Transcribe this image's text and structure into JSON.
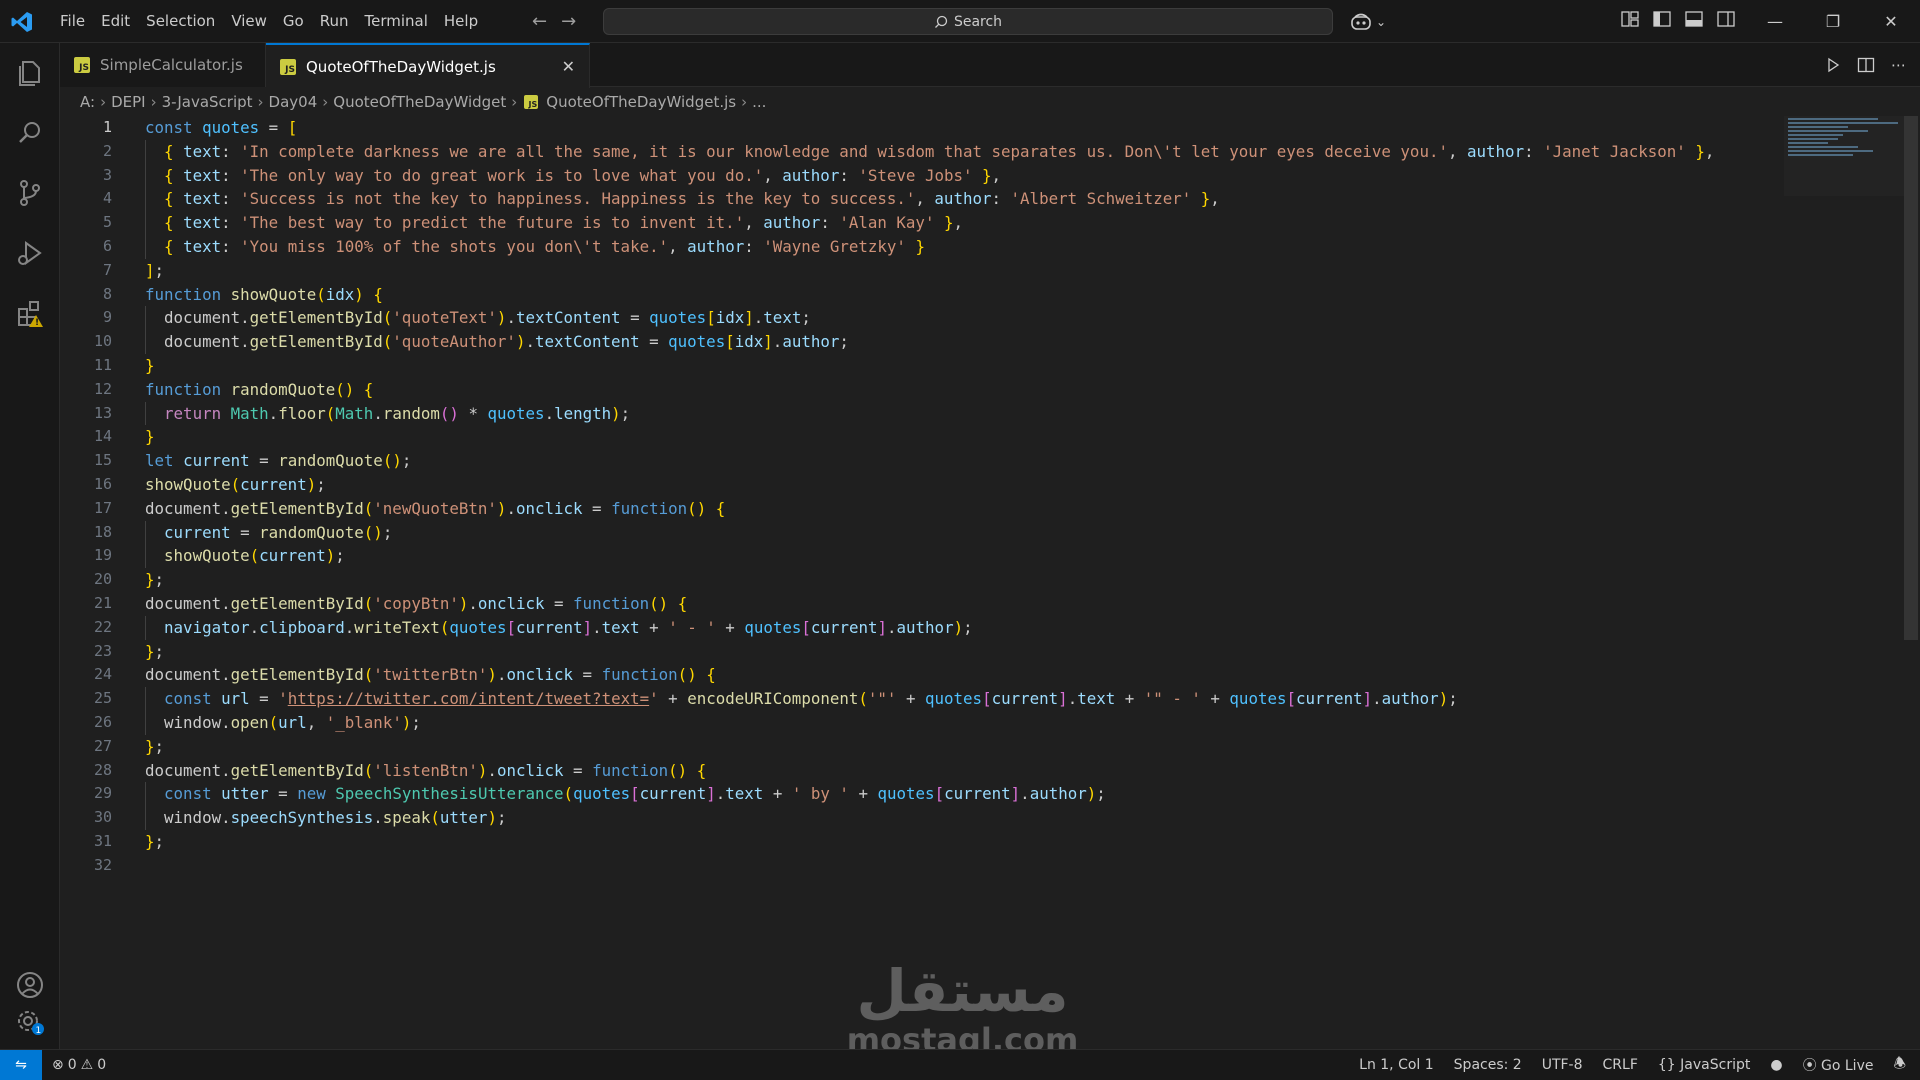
{
  "menu": [
    "File",
    "Edit",
    "Selection",
    "View",
    "Go",
    "Run",
    "Terminal",
    "Help"
  ],
  "search": {
    "label": "Search"
  },
  "tabs": [
    {
      "label": "SimpleCalculator.js",
      "badge": "JS"
    },
    {
      "label": "QuoteOfTheDayWidget.js",
      "badge": "JS"
    }
  ],
  "breadcrumb": [
    "A:",
    "DEPI",
    "3-JavaScript",
    "Day04",
    "QuoteOfTheDayWidget",
    "QuoteOfTheDayWidget.js",
    "..."
  ],
  "line_numbers": [
    "1",
    "2",
    "3",
    "4",
    "5",
    "6",
    "7",
    "8",
    "9",
    "10",
    "11",
    "12",
    "13",
    "14",
    "15",
    "16",
    "17",
    "18",
    "19",
    "20",
    "21",
    "22",
    "23",
    "24",
    "25",
    "26",
    "27",
    "28",
    "29",
    "30",
    "31",
    "32"
  ],
  "code_lines": [
    "const quotes = [",
    "  { text: 'In complete darkness we are all the same, it is our knowledge and wisdom that separates us. Don\\'t let your eyes deceive you.', author: 'Janet Jackson' },",
    "  { text: 'The only way to do great work is to love what you do.', author: 'Steve Jobs' },",
    "  { text: 'Success is not the key to happiness. Happiness is the key to success.', author: 'Albert Schweitzer' },",
    "  { text: 'The best way to predict the future is to invent it.', author: 'Alan Kay' },",
    "  { text: 'You miss 100% of the shots you don\\'t take.', author: 'Wayne Gretzky' }",
    "];",
    "function showQuote(idx) {",
    "  document.getElementById('quoteText').textContent = quotes[idx].text;",
    "  document.getElementById('quoteAuthor').textContent = quotes[idx].author;",
    "}",
    "function randomQuote() {",
    "  return Math.floor(Math.random() * quotes.length);",
    "}",
    "let current = randomQuote();",
    "showQuote(current);",
    "document.getElementById('newQuoteBtn').onclick = function() {",
    "  current = randomQuote();",
    "  showQuote(current);",
    "};",
    "document.getElementById('copyBtn').onclick = function() {",
    "  navigator.clipboard.writeText(quotes[current].text + ' - ' + quotes[current].author);",
    "};",
    "document.getElementById('twitterBtn').onclick = function() {",
    "  const url = 'https://twitter.com/intent/tweet?text=' + encodeURIComponent('\"' + quotes[current].text + '\" - ' + quotes[current].author);",
    "  window.open(url, '_blank');",
    "};",
    "document.getElementById('listenBtn').onclick = function() {",
    "  const utter = new SpeechSynthesisUtterance(quotes[current].text + ' by ' + quotes[current].author);",
    "  window.speechSynthesis.speak(utter);",
    "};",
    ""
  ],
  "watermark": {
    "arabic": "مستقل",
    "latin": "mostaql.com"
  },
  "status": {
    "problems_errors": "0",
    "problems_warnings": "0",
    "cursor": "Ln 1, Col 1",
    "spaces": "Spaces: 2",
    "encoding": "UTF-8",
    "eol": "CRLF",
    "language": "JavaScript",
    "golive": "Go Live",
    "accounts_badge": "1"
  },
  "colors": {
    "accent": "#0078d4",
    "background": "#1f1f1f",
    "chrome": "#181818"
  }
}
